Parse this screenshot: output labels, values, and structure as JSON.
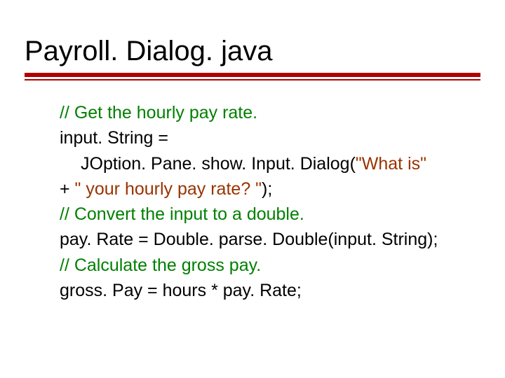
{
  "title": "Payroll. Dialog. java",
  "lines": {
    "l1": "// Get the hourly pay rate.",
    "l2": "input. String =",
    "l3a": "JOption. Pane. show. Input. Dialog(",
    "l3b": "\"What is\"",
    "l4a": "+  ",
    "l4b": "\" your hourly pay rate? \"",
    "l4c": ");",
    "l5": "// Convert the input to a double.",
    "l6": "pay. Rate = Double. parse. Double(input. String);",
    "l7": "// Calculate the gross pay.",
    "l8": "gross. Pay = hours * pay. Rate;"
  }
}
